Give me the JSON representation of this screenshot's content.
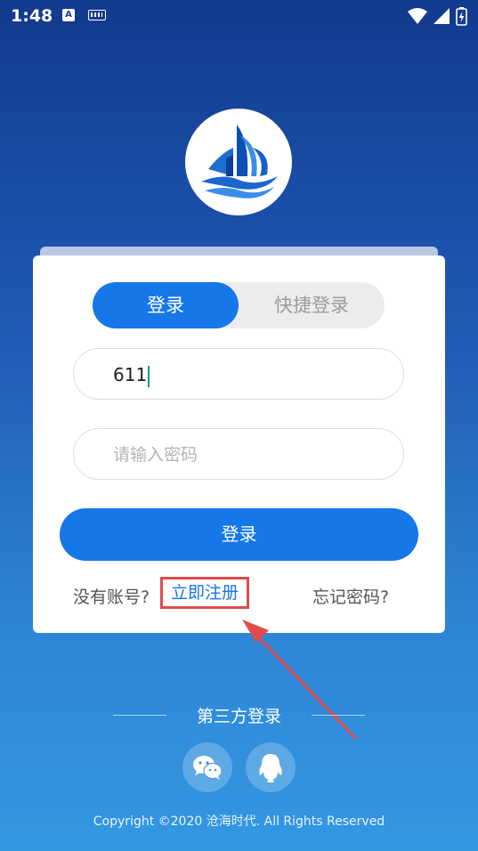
{
  "status_bar": {
    "time": "1:48",
    "notif_icon_label": "A"
  },
  "tabs": [
    {
      "label": "登录",
      "active": true
    },
    {
      "label": "快捷登录",
      "active": false
    }
  ],
  "form": {
    "username_value": "611",
    "password_placeholder": "请输入密码",
    "login_button": "登录"
  },
  "links": {
    "no_account": "没有账号?",
    "register": "立即注册",
    "forgot": "忘记密码?"
  },
  "third_party": {
    "title": "第三方登录",
    "icons": [
      "wechat-icon",
      "qq-icon"
    ]
  },
  "footer": {
    "copyright": "Copyright ©2020 沧海时代. All Rights Reserved"
  },
  "colors": {
    "primary": "#1677e8",
    "highlight": "#e04b4b",
    "bg_top": "#123a8e",
    "bg_bottom": "#3298e2"
  }
}
